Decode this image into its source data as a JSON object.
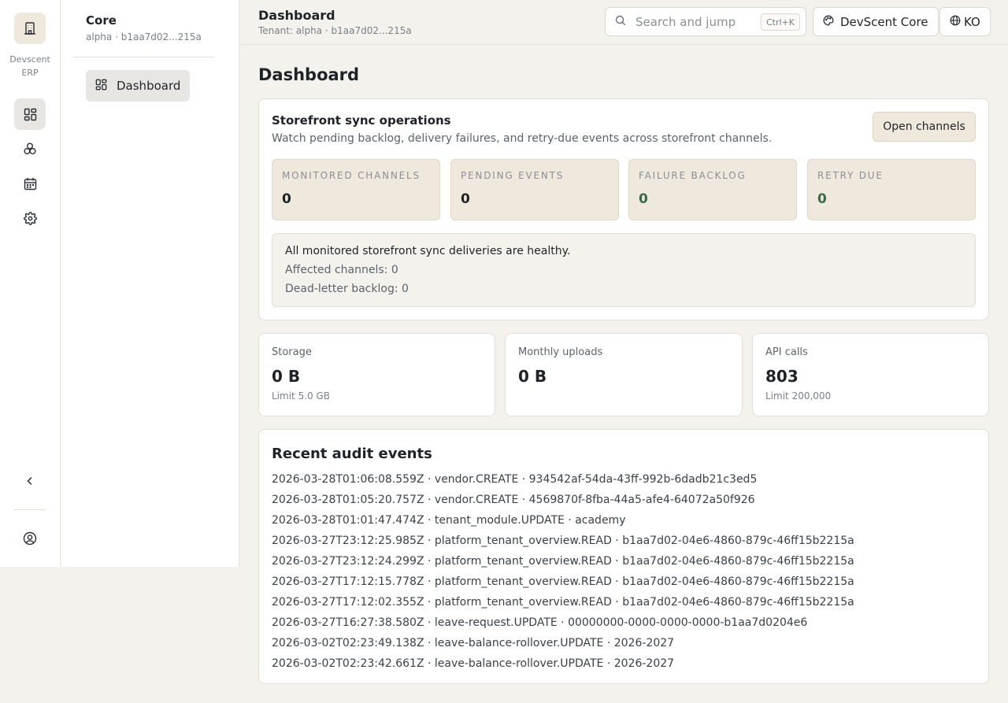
{
  "rail": {
    "brand": "Devscent ERP",
    "icons": [
      "building-icon",
      "dashboard-icon",
      "modules-icon",
      "calendar-icon",
      "gear-icon",
      "chevron-left-icon",
      "user-circle-icon"
    ]
  },
  "sidebar": {
    "title": "Core",
    "subtitle": "alpha · b1aa7d02...215a",
    "items": [
      {
        "label": "Dashboard",
        "icon": "dashboard-icon",
        "active": true
      }
    ]
  },
  "header": {
    "title": "Dashboard",
    "subtitle": "Tenant: alpha · b1aa7d02...215a",
    "search_placeholder": "Search and jump",
    "search_shortcut": "Ctrl+K",
    "theme_label": "DevScent Core",
    "lang_label": "KO"
  },
  "main": {
    "title": "Dashboard",
    "sync": {
      "title": "Storefront sync operations",
      "description": "Watch pending backlog, delivery failures, and retry-due events across storefront channels.",
      "open_button": "Open channels",
      "metrics": [
        {
          "label": "Monitored channels",
          "value": "0"
        },
        {
          "label": "Pending events",
          "value": "0"
        },
        {
          "label": "Failure backlog",
          "value": "0"
        },
        {
          "label": "Retry due",
          "value": "0"
        }
      ],
      "status": {
        "message": "All monitored storefront sync deliveries are healthy.",
        "affected": "Affected channels: 0",
        "dead_letter": "Dead-letter backlog: 0"
      }
    },
    "usage": [
      {
        "label": "Storage",
        "value": "0 B",
        "limit": "Limit 5.0 GB"
      },
      {
        "label": "Monthly uploads",
        "value": "0 B",
        "limit": ""
      },
      {
        "label": "API calls",
        "value": "803",
        "limit": "Limit 200,000"
      }
    ],
    "audit": {
      "title": "Recent audit events",
      "events": [
        "2026-03-28T01:06:08.559Z · vendor.CREATE · 934542af-54da-43ff-992b-6dadb21c3ed5",
        "2026-03-28T01:05:20.757Z · vendor.CREATE · 4569870f-8fba-44a5-afe4-64072a50f926",
        "2026-03-28T01:01:47.474Z · tenant_module.UPDATE · academy",
        "2026-03-27T23:12:25.985Z · platform_tenant_overview.READ · b1aa7d02-04e6-4860-879c-46ff15b2215a",
        "2026-03-27T23:12:24.299Z · platform_tenant_overview.READ · b1aa7d02-04e6-4860-879c-46ff15b2215a",
        "2026-03-27T17:12:15.778Z · platform_tenant_overview.READ · b1aa7d02-04e6-4860-879c-46ff15b2215a",
        "2026-03-27T17:12:02.355Z · platform_tenant_overview.READ · b1aa7d02-04e6-4860-879c-46ff15b2215a",
        "2026-03-27T16:27:38.580Z · leave-request.UPDATE · 00000000-0000-0000-0000-b1aa7d0204e6",
        "2026-03-02T02:23:49.138Z · leave-balance-rollover.UPDATE · 2026-2027",
        "2026-03-02T02:23:42.661Z · leave-balance-rollover.UPDATE · 2026-2027"
      ]
    }
  }
}
